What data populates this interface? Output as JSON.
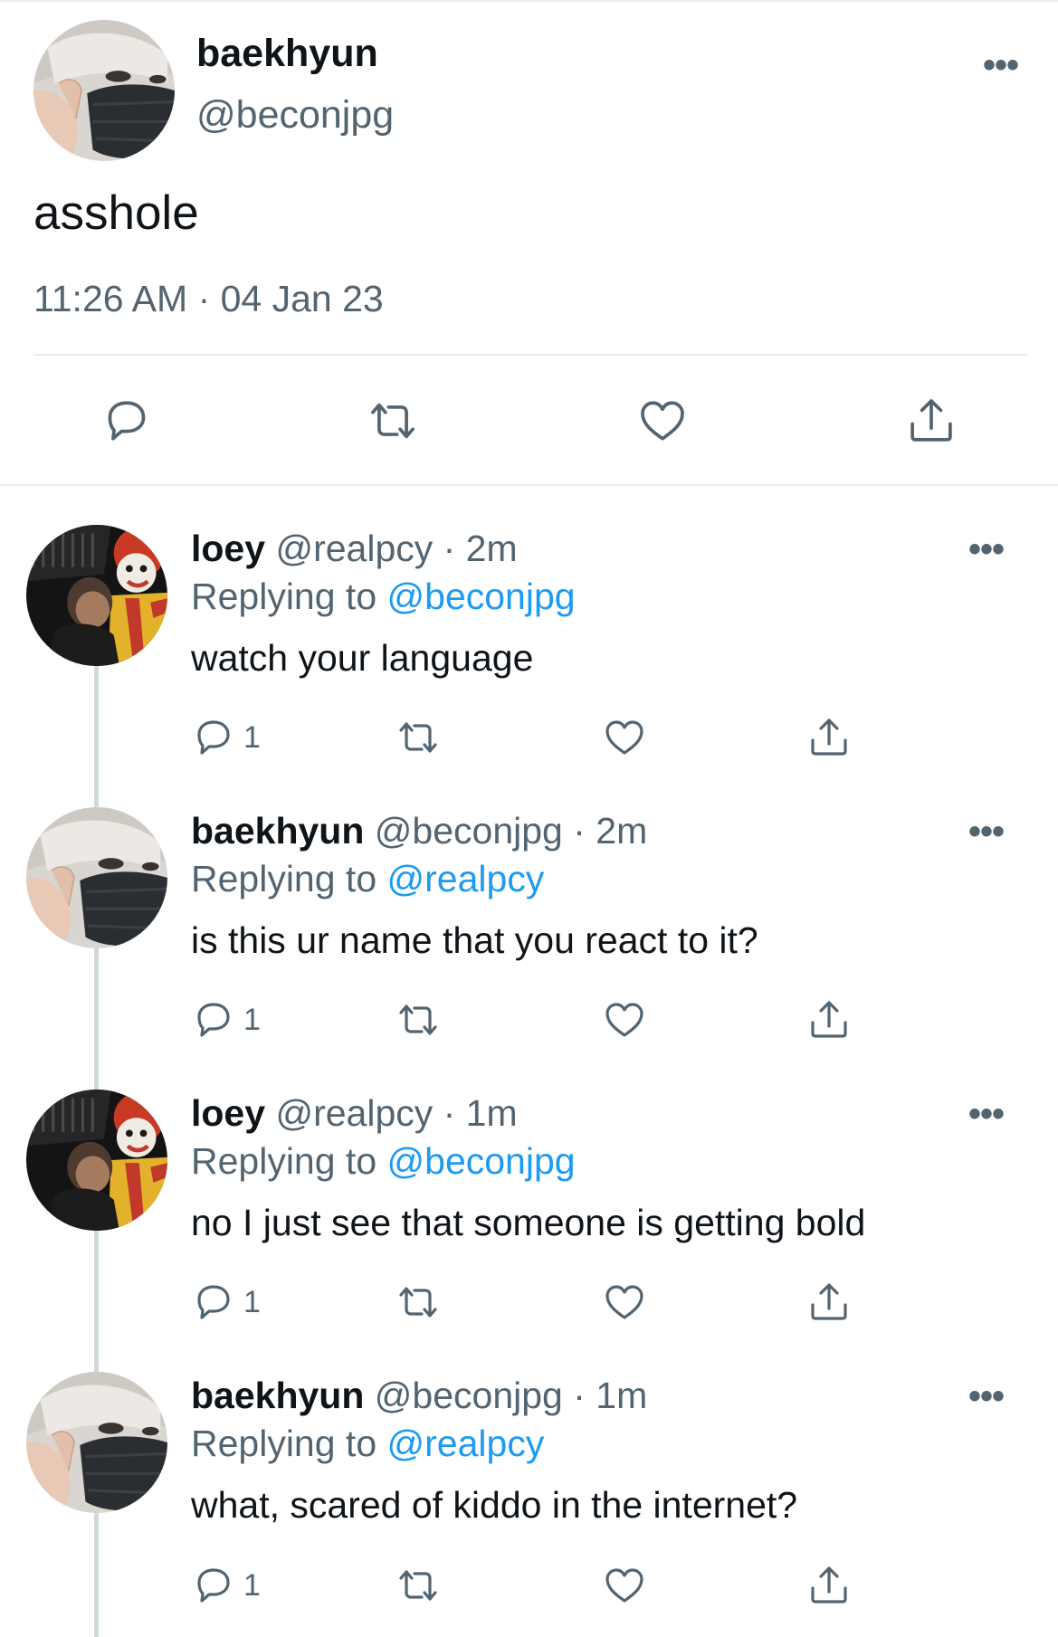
{
  "main_tweet": {
    "display_name": "baekhyun",
    "handle": "@beconjpg",
    "text": "asshole",
    "time": "11:26 AM · 04 Jan 23",
    "more_label": "•••"
  },
  "replies": [
    {
      "display_name": "loey",
      "handle_time": "@realpcy · 2m",
      "replying_prefix": "Replying to",
      "replying_to": "@beconjpg",
      "text": "watch your language",
      "reply_count": "1",
      "avatar": "mcdonald-photo"
    },
    {
      "display_name": "baekhyun",
      "handle_time": "@beconjpg · 2m",
      "replying_prefix": "Replying to",
      "replying_to": "@realpcy",
      "text": "is this ur name that you react to it?",
      "reply_count": "1",
      "avatar": "masked-photo"
    },
    {
      "display_name": "loey",
      "handle_time": "@realpcy · 1m",
      "replying_prefix": "Replying to",
      "replying_to": "@beconjpg",
      "text": "no I just see that someone is getting bold",
      "reply_count": "1",
      "avatar": "mcdonald-photo"
    },
    {
      "display_name": "baekhyun",
      "handle_time": "@beconjpg · 1m",
      "replying_prefix": "Replying to",
      "replying_to": "@realpcy",
      "text": "what, scared of kiddo in the internet?",
      "reply_count": "1",
      "avatar": "masked-photo"
    }
  ],
  "colors": {
    "link": "#1d9bf0",
    "secondary_text": "#536471",
    "divider": "#e6ecf0"
  },
  "icons": [
    "comment-icon",
    "retweet-icon",
    "like-icon",
    "share-icon",
    "more-icon"
  ]
}
